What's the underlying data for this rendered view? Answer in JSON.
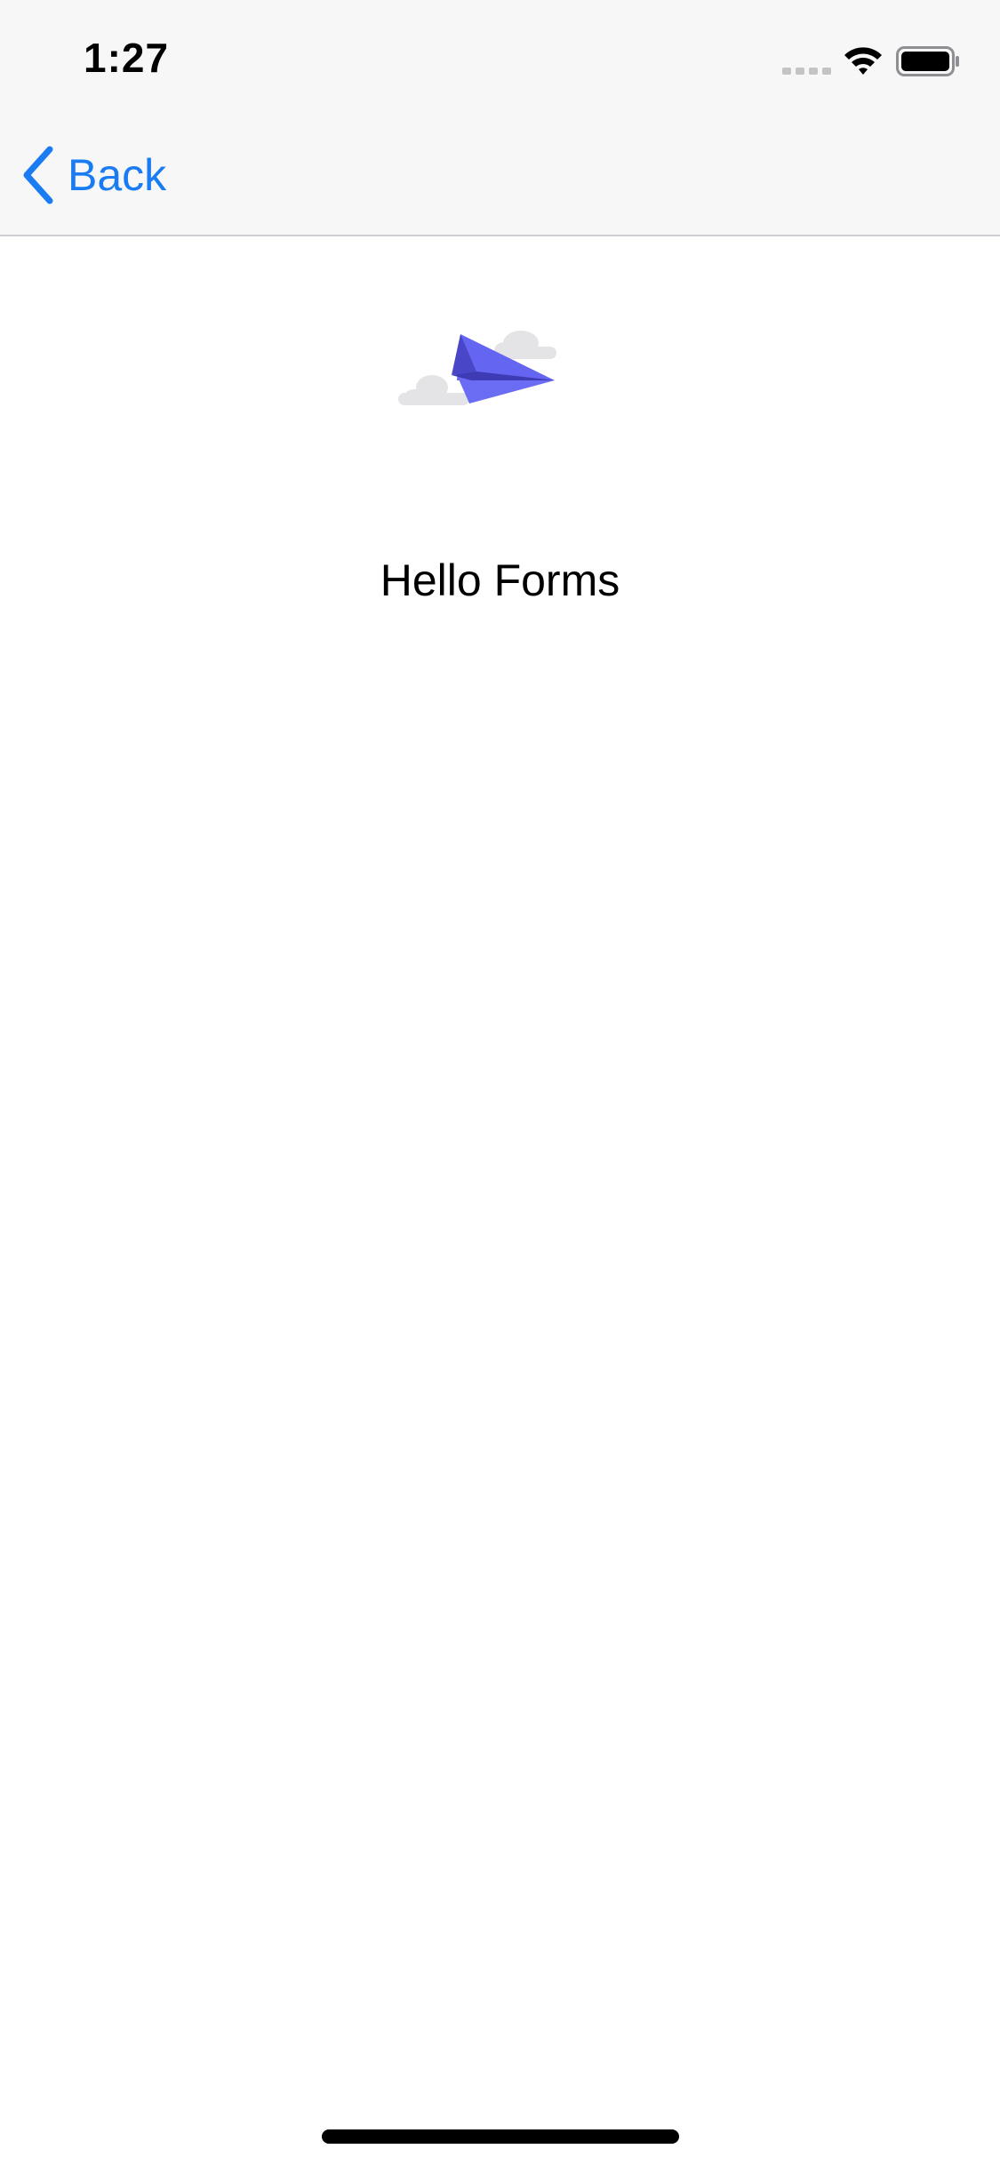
{
  "status_bar": {
    "time": "1:27"
  },
  "nav": {
    "back_label": "Back"
  },
  "content": {
    "title": "Hello Forms"
  },
  "colors": {
    "accent": "#1a7cf2",
    "plane_light": "#6466f1",
    "plane_dark": "#4a46c8",
    "cloud": "#e4e4e7"
  }
}
